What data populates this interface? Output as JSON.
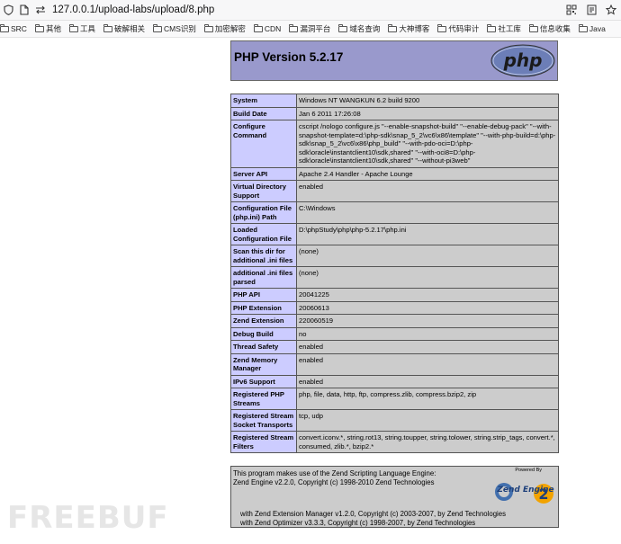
{
  "browser": {
    "url": "127.0.0.1/upload-labs/upload/8.php"
  },
  "bookmarks": [
    {
      "label": "SRC"
    },
    {
      "label": "其他"
    },
    {
      "label": "工具"
    },
    {
      "label": "破解相关"
    },
    {
      "label": "CMS识别"
    },
    {
      "label": "加密解密"
    },
    {
      "label": "CDN"
    },
    {
      "label": "漏洞平台"
    },
    {
      "label": "域名查询"
    },
    {
      "label": "大神博客"
    },
    {
      "label": "代码审计"
    },
    {
      "label": "社工库"
    },
    {
      "label": "信息收集"
    },
    {
      "label": "Java"
    }
  ],
  "phpinfo": {
    "title": "PHP Version 5.2.17",
    "logo_text": "php",
    "rows": [
      {
        "key": "System",
        "value": "Windows NT WANGKUN 6.2 build 9200"
      },
      {
        "key": "Build Date",
        "value": "Jan 6 2011 17:26:08"
      },
      {
        "key": "Configure Command",
        "value": "cscript /nologo configure.js \"--enable-snapshot-build\" \"--enable-debug-pack\" \"--with-snapshot-template=d:\\php-sdk\\snap_5_2\\vc6\\x86\\template\" \"--with-php-build=d:\\php-sdk\\snap_5_2\\vc6\\x86\\php_build\" \"--with-pdo-oci=D:\\php-sdk\\oracle\\instantclient10\\sdk,shared\" \"--with-oci8=D:\\php-sdk\\oracle\\instantclient10\\sdk,shared\" \"--without-pi3web\""
      },
      {
        "key": "Server API",
        "value": "Apache 2.4 Handler - Apache Lounge"
      },
      {
        "key": "Virtual Directory Support",
        "value": "enabled"
      },
      {
        "key": "Configuration File (php.ini) Path",
        "value": "C:\\Windows"
      },
      {
        "key": "Loaded Configuration File",
        "value": "D:\\phpStudy\\php\\php-5.2.17\\php.ini"
      },
      {
        "key": "Scan this dir for additional .ini files",
        "value": "(none)"
      },
      {
        "key": "additional .ini files parsed",
        "value": "(none)"
      },
      {
        "key": "PHP API",
        "value": "20041225"
      },
      {
        "key": "PHP Extension",
        "value": "20060613"
      },
      {
        "key": "Zend Extension",
        "value": "220060519"
      },
      {
        "key": "Debug Build",
        "value": "no"
      },
      {
        "key": "Thread Safety",
        "value": "enabled"
      },
      {
        "key": "Zend Memory Manager",
        "value": "enabled"
      },
      {
        "key": "IPv6 Support",
        "value": "enabled"
      },
      {
        "key": "Registered PHP Streams",
        "value": "php, file, data, http, ftp, compress.zlib, compress.bzip2, zip"
      },
      {
        "key": "Registered Stream Socket Transports",
        "value": "tcp, udp"
      },
      {
        "key": "Registered Stream Filters",
        "value": "convert.iconv.*, string.rot13, string.toupper, string.tolower, string.strip_tags, convert.*, consumed, zlib.*, bzip2.*"
      }
    ]
  },
  "zend": {
    "line1": "This program makes use of the Zend Scripting Language Engine:",
    "line2": "Zend Engine v2.2.0, Copyright (c) 1998-2010 Zend Technologies",
    "line3": "with Zend Extension Manager v1.2.0, Copyright (c) 2003-2007, by Zend Technologies",
    "line4": "with Zend Optimizer v3.3.3, Copyright (c) 1998-2007, by Zend Technologies",
    "powered_by": "Powered By",
    "logo_text": "Zend Engine"
  },
  "watermark": "FREEBUF",
  "colors": {
    "header_bg": "#9999cc",
    "key_bg": "#ccccff",
    "value_bg": "#cccccc"
  }
}
